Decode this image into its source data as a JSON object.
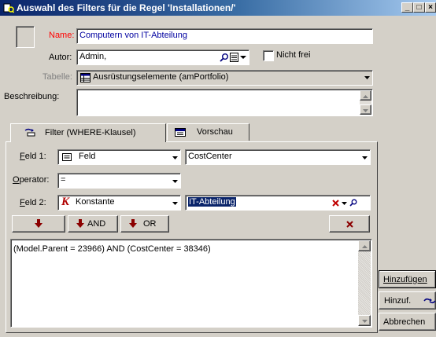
{
  "window": {
    "title": "Auswahl des Filters für die Regel 'Installationen/'",
    "minimize": "_",
    "maximize": "□",
    "close": "×"
  },
  "form": {
    "name_label": "Name:",
    "name_value": "Computern von IT-Abteilung",
    "autor_label": "Autor:",
    "autor_value": "Admin,",
    "nicht_frei_label": "Nicht frei",
    "tabelle_label": "Tabelle:",
    "tabelle_value": "Ausrüstungselemente (amPortfolio)",
    "beschreibung_label": "Beschreibung:"
  },
  "tabs": [
    {
      "label": "Filter (WHERE-Klausel)"
    },
    {
      "label": "Vorschau"
    }
  ],
  "filter": {
    "feld1_label": "Feld 1:",
    "feld1_type": "Feld",
    "feld1_value": "CostCenter",
    "operator_label": "Operator:",
    "operator_value": "=",
    "feld2_label": "Feld 2:",
    "feld2_type": "Konstante",
    "feld2_value": "IT-Abteilung",
    "and_label": "AND",
    "or_label": "OR",
    "clause": "(Model.Parent = 23966) AND (CostCenter = 38346)"
  },
  "side_buttons": {
    "hinzufuegen": "Hinzufügen",
    "hinzuf": "Hinzuf.",
    "abbrechen": "Abbrechen"
  },
  "colors": {
    "title_start": "#0a246a",
    "title_end": "#a6caf0",
    "label_red": "#ff0000",
    "arrow_red": "#8b0000",
    "selection": "#0a246a"
  }
}
